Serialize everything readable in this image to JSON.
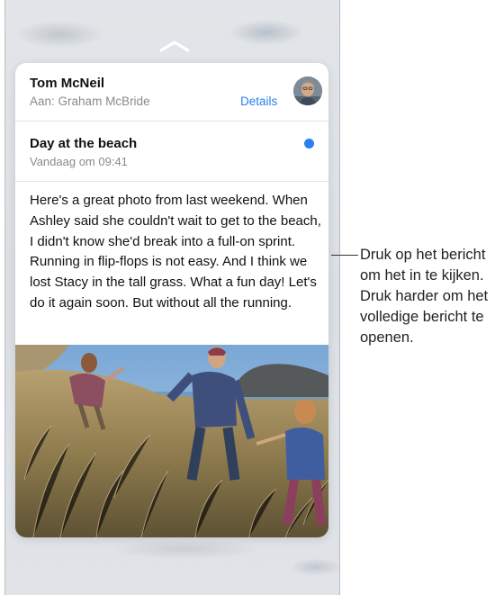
{
  "email": {
    "sender": "Tom McNeil",
    "to_prefix": "Aan:",
    "recipient": "Graham McBride",
    "details_label": "Details",
    "subject": "Day at the beach",
    "datetime": "Vandaag om 09:41",
    "body": "Here's a great photo from last weekend. When Ashley said she couldn't wait to get to the beach, I didn't know she'd break into a full-on sprint. Running in flip-flops is not easy. And I think we lost Stacy in the tall grass. What a fun day! Let's do it again soon. But without all the running."
  },
  "callout": {
    "text": "Druk op het bericht om het in te kijken. Druk harder om het volledige bericht te openen."
  },
  "colors": {
    "accent": "#2b7ff0",
    "unread_dot": "#2b7ff0",
    "secondary_text": "#8a8a8e"
  },
  "icons": {
    "top": "chevron-up-icon",
    "avatar": "avatar-photo",
    "unread": "unread-dot"
  }
}
